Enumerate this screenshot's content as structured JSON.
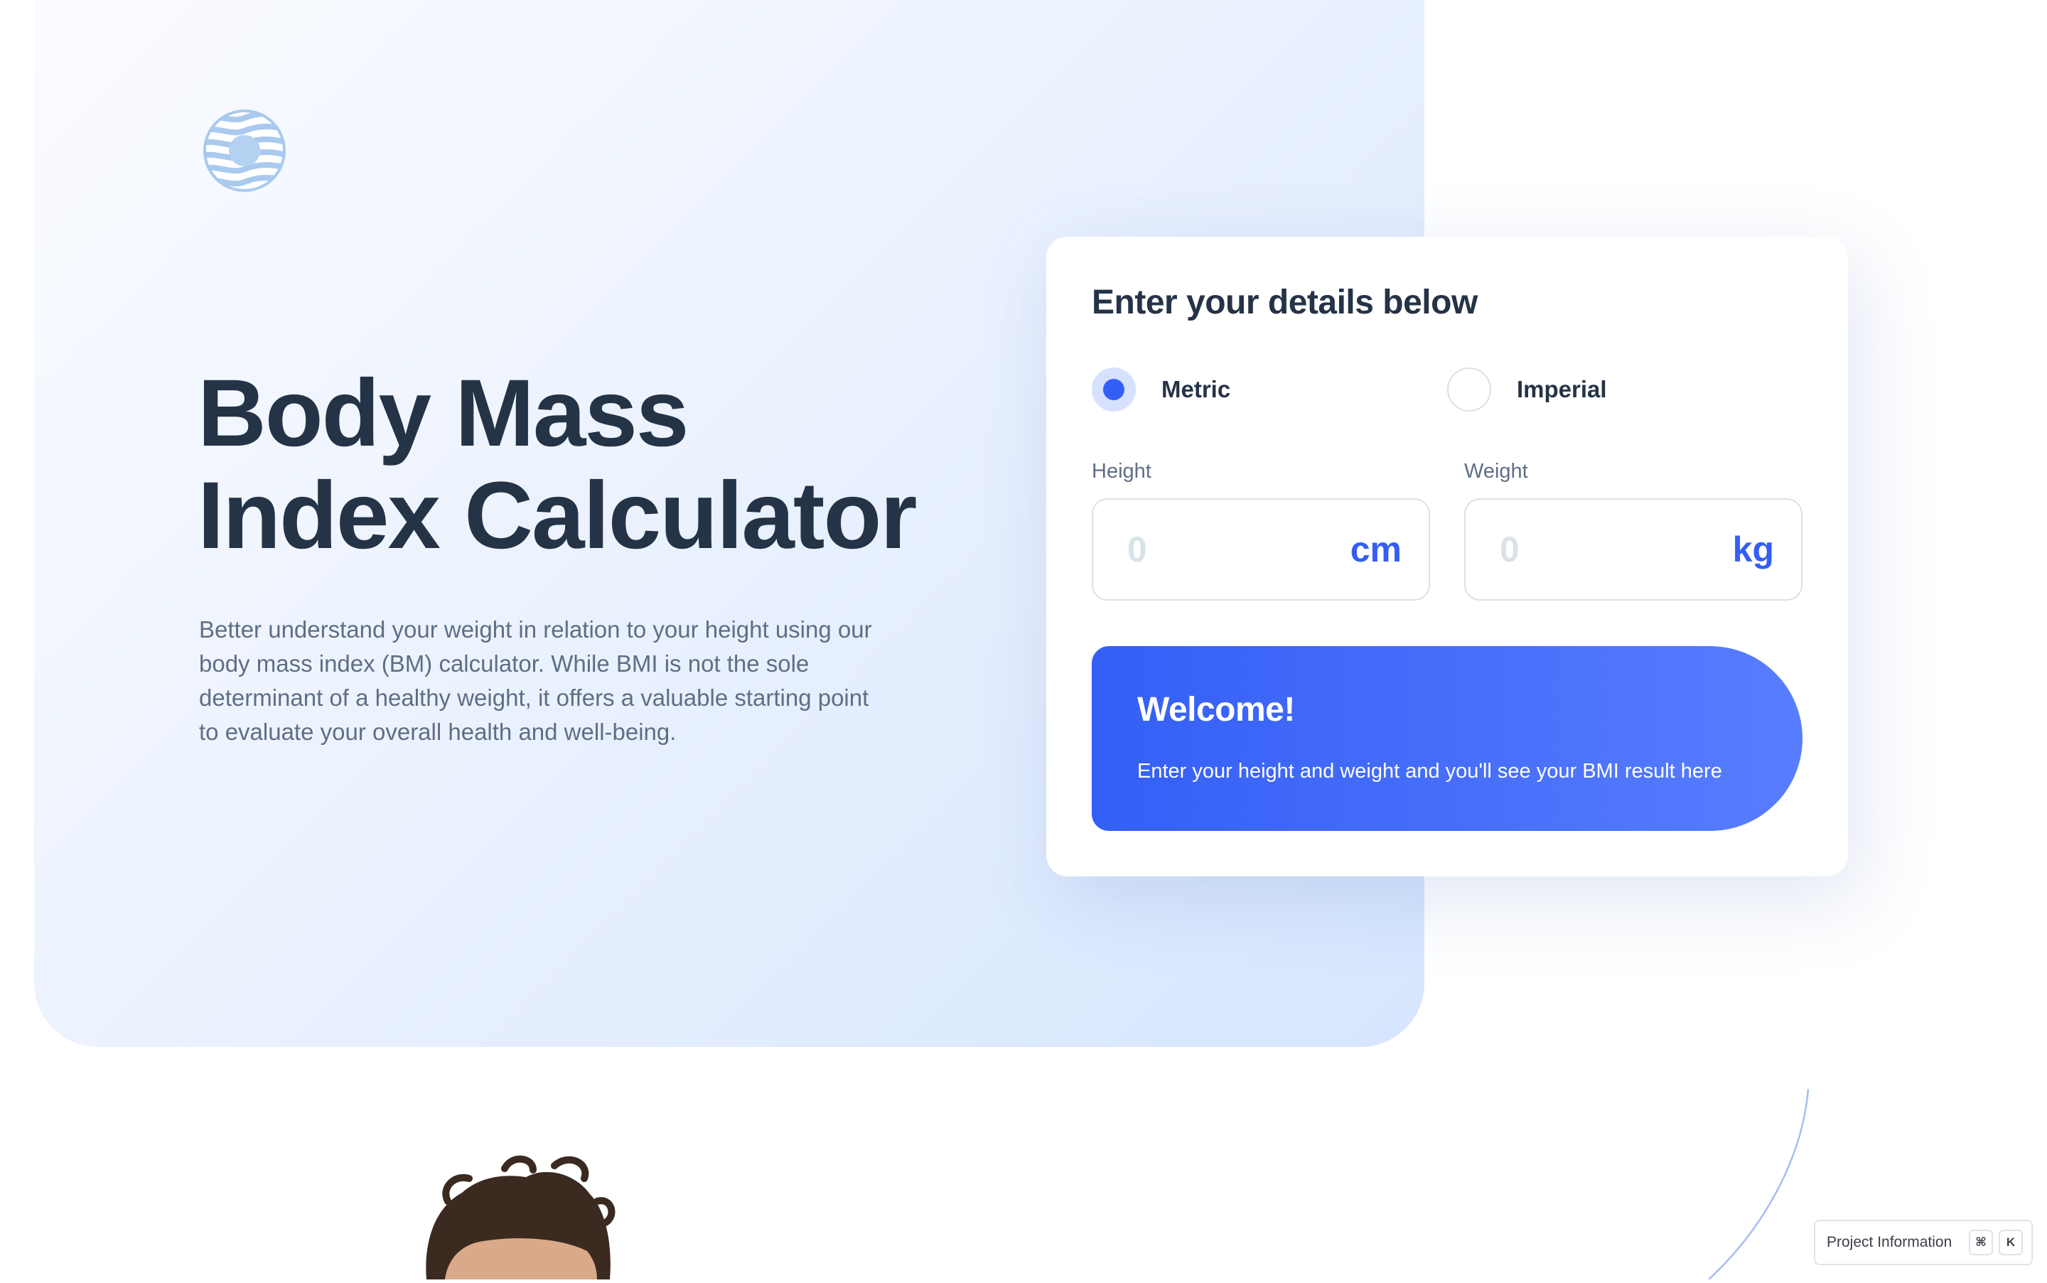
{
  "hero": {
    "logo_icon": "striped-circle-logo-icon",
    "title_line1": "Body Mass",
    "title_line2": "Index Calculator",
    "description": "Better understand your weight in relation to your height using our body mass index (BM) calculator. While BMI is not the sole determinant of a healthy weight, it offers a valuable starting point to evaluate your overall health and well-being."
  },
  "form": {
    "heading": "Enter your details below",
    "units": [
      {
        "label": "Metric",
        "selected": true
      },
      {
        "label": "Imperial",
        "selected": false
      }
    ],
    "height": {
      "label": "Height",
      "placeholder": "0",
      "value": "",
      "unit": "cm"
    },
    "weight": {
      "label": "Weight",
      "placeholder": "0",
      "value": "",
      "unit": "kg"
    }
  },
  "result": {
    "title": "Welcome!",
    "text": "Enter your height and weight and you'll see your BMI result here"
  },
  "widget": {
    "label": "Project Information",
    "key1": "⌘",
    "key2": "K"
  },
  "colors": {
    "accent": "#345FF6",
    "heading": "#253347",
    "body": "#5E6E85",
    "border": "#D8E2E7"
  }
}
